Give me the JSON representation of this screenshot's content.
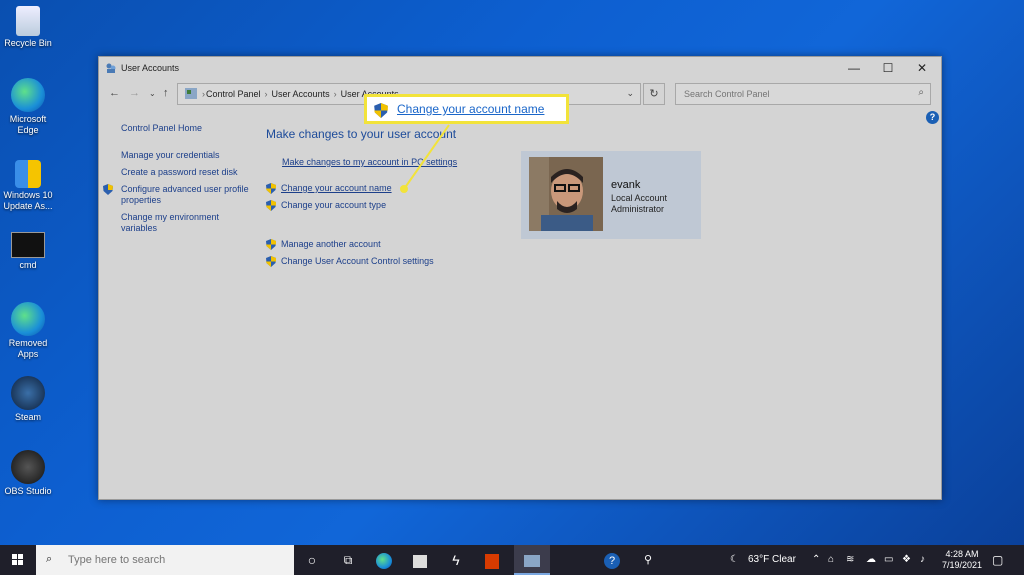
{
  "desktop": {
    "icons": [
      {
        "label": "Recycle Bin"
      },
      {
        "label": "Microsoft Edge"
      },
      {
        "label": "Windows 10 Update As..."
      },
      {
        "label": "cmd"
      },
      {
        "label": "Removed Apps"
      },
      {
        "label": "Steam"
      },
      {
        "label": "OBS Studio"
      }
    ]
  },
  "window": {
    "title": "User Accounts",
    "controls": {
      "minimize": "—",
      "maximize": "☐",
      "close": "✕"
    },
    "breadcrumbs": [
      "Control Panel",
      "User Accounts",
      "User Accounts"
    ],
    "search_placeholder": "Search Control Panel"
  },
  "left_pane": {
    "home": "Control Panel Home",
    "links": [
      "Manage your credentials",
      "Create a password reset disk",
      "Configure advanced user profile properties",
      "Change my environment variables"
    ]
  },
  "main": {
    "heading": "Make changes to your user account",
    "pc_settings_link": "Make changes to my account in PC settings",
    "links": [
      "Change your account name",
      "Change your account type",
      "Manage another account",
      "Change User Account Control settings"
    ]
  },
  "user": {
    "name": "evank",
    "type1": "Local Account",
    "type2": "Administrator"
  },
  "callout": {
    "text": "Change your account name",
    "highlight_color": "#f2e33a"
  },
  "taskbar": {
    "search_placeholder": "Type here to search",
    "weather": "63°F  Clear",
    "time": "4:28 AM",
    "date": "7/19/2021"
  }
}
